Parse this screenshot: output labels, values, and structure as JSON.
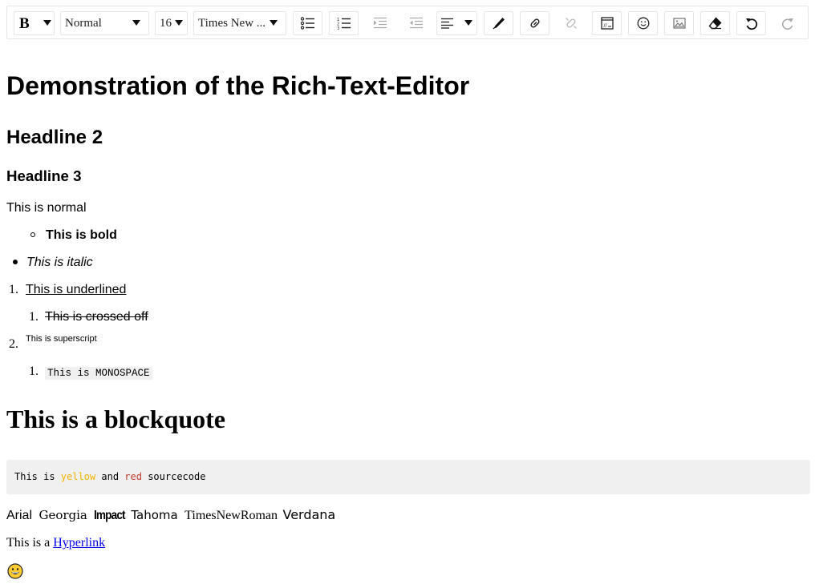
{
  "toolbar": {
    "bold_label": "B",
    "format_value": "Normal",
    "size_value": "16",
    "font_value": "Times New ...",
    "icons": [
      "bold-icon",
      "unordered-list-icon",
      "ordered-list-icon",
      "indent-icon",
      "outdent-icon",
      "align-left-icon",
      "pencil-icon",
      "link-icon",
      "unlink-icon",
      "code-block-icon",
      "emoji-icon",
      "image-icon",
      "eraser-icon",
      "undo-icon",
      "redo-icon"
    ]
  },
  "document": {
    "h1": "Demonstration of the Rich-Text-Editor",
    "h2": "Headline 2",
    "h3": "Headline 3",
    "normal": "This is normal",
    "bold": "This is bold",
    "italic": "This is italic",
    "underlined": "This is underlined",
    "crossed": "This is crossed off",
    "superscript": "This is superscript",
    "monospace": "This is MONOSPACE",
    "list_numbers": [
      "1.",
      "1.",
      "2.",
      "1."
    ],
    "blockquote": "This is a blockquote",
    "code": {
      "part1": "This is ",
      "yellow": "yellow",
      "part2": " and ",
      "red": "red",
      "part3": " sourcecode"
    },
    "fonts": [
      "Arial",
      "Georgia",
      "Impact",
      "Tahoma",
      "TimesNewRoman",
      "Verdana"
    ],
    "link_prefix": "This is a ",
    "link_text": "Hyperlink"
  },
  "colors": {
    "code_yellow": "#f0b400",
    "code_red": "#c0392b",
    "link": "#0000ee",
    "border": "#e6e6e6"
  }
}
